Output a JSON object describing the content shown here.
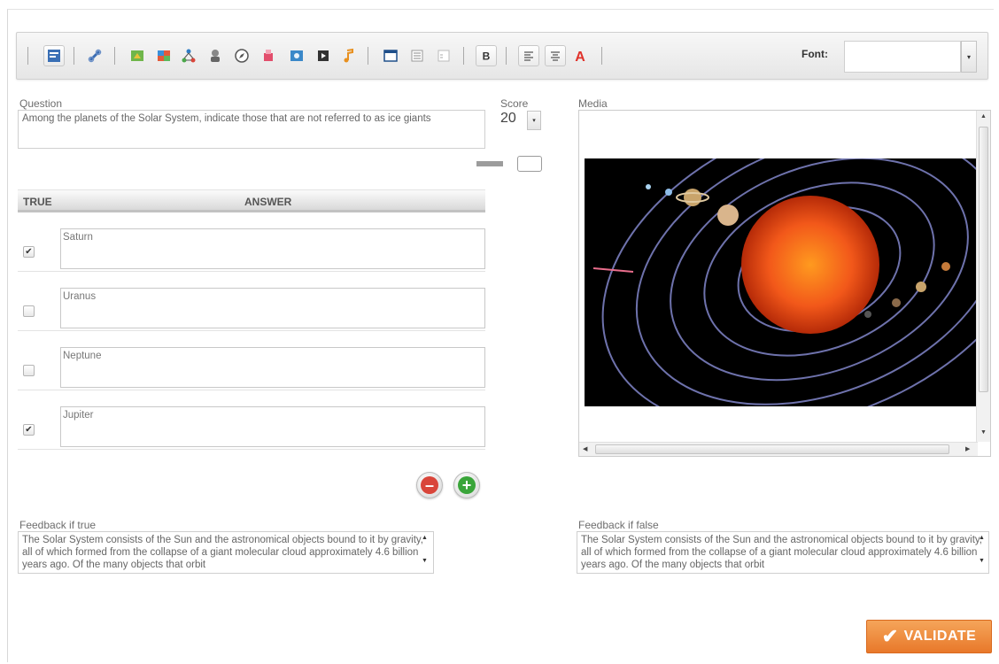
{
  "toolbar": {
    "font_label": "Font:",
    "font_value": "",
    "icons": [
      "form-icon",
      "link-icon",
      "tree-icon",
      "gallery-icon",
      "network-icon",
      "robot-icon",
      "compass-icon",
      "paint-icon",
      "photo-icon",
      "video-icon",
      "music-icon",
      "window-icon",
      "list-icon",
      "text-block-icon",
      "bold-icon",
      "align-left-icon",
      "align-center-icon",
      "font-color-icon"
    ]
  },
  "question": {
    "label": "Question",
    "text": "Among the planets of the Solar System, indicate those that are not referred to as ice giants"
  },
  "score": {
    "label": "Score",
    "value": "20"
  },
  "answers_table": {
    "col_true": "TRUE",
    "col_answer": "ANSWER",
    "rows": [
      {
        "answer": "Saturn",
        "checked": true
      },
      {
        "answer": "Uranus",
        "checked": false
      },
      {
        "answer": "Neptune",
        "checked": false
      },
      {
        "answer": "Jupiter",
        "checked": true
      }
    ]
  },
  "media": {
    "label": "Media",
    "image_description_icon": "solar-system-image"
  },
  "feedback_true": {
    "label": "Feedback if true",
    "text": "The Solar System consists of the Sun and the astronomical objects bound to it by gravity, all of which formed from the collapse of a giant molecular cloud approximately 4.6 billion years ago. Of the many objects that orbit"
  },
  "feedback_false": {
    "label": "Feedback if false",
    "text": "The Solar System consists of the Sun and the astronomical objects bound to it by gravity, all of which formed from the collapse of a giant molecular cloud approximately 4.6 billion years ago. Of the many objects that orbit"
  },
  "actions": {
    "validate_label": "VALIDATE"
  },
  "colors": {
    "accent_orange": "#ee8a3c",
    "remove_red": "#d9453a",
    "add_green": "#3aa53a"
  }
}
